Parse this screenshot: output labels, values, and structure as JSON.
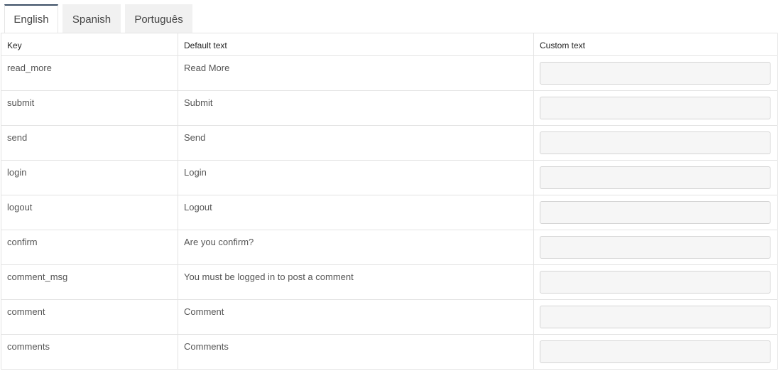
{
  "tabs": [
    {
      "label": "English",
      "active": true
    },
    {
      "label": "Spanish",
      "active": false
    },
    {
      "label": "Português",
      "active": false
    }
  ],
  "table": {
    "headers": {
      "key": "Key",
      "default": "Default text",
      "custom": "Custom text"
    },
    "rows": [
      {
        "key": "read_more",
        "default": "Read More",
        "custom": ""
      },
      {
        "key": "submit",
        "default": "Submit",
        "custom": ""
      },
      {
        "key": "send",
        "default": "Send",
        "custom": ""
      },
      {
        "key": "login",
        "default": "Login",
        "custom": ""
      },
      {
        "key": "logout",
        "default": "Logout",
        "custom": ""
      },
      {
        "key": "confirm",
        "default": "Are you confirm?",
        "custom": ""
      },
      {
        "key": "comment_msg",
        "default": "You must be logged in to post a comment",
        "custom": ""
      },
      {
        "key": "comment",
        "default": "Comment",
        "custom": ""
      },
      {
        "key": "comments",
        "default": "Comments",
        "custom": ""
      }
    ]
  }
}
